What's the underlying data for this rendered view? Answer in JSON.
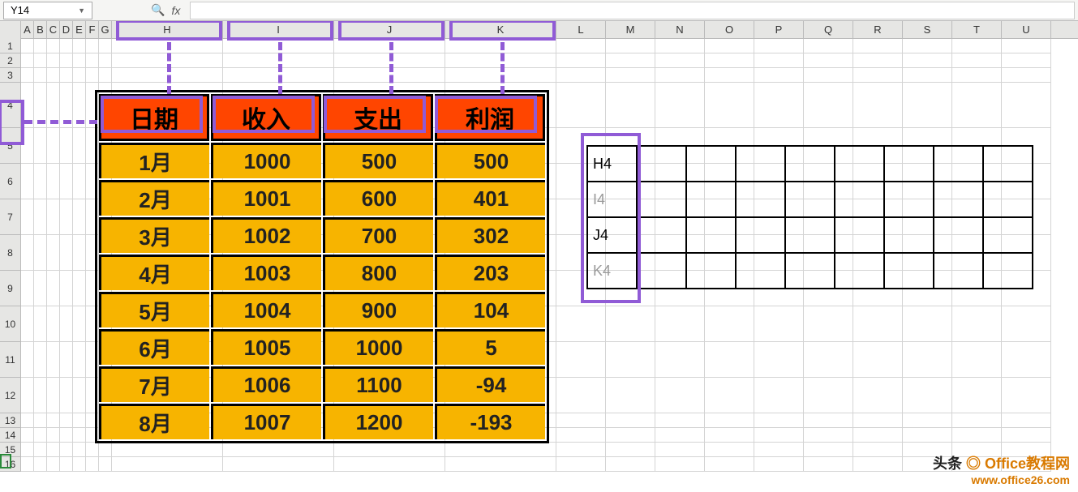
{
  "namebox": "Y14",
  "fx_label": "fx",
  "columns": {
    "narrow": [
      "A",
      "B",
      "C",
      "D",
      "E",
      "F",
      "G"
    ],
    "wide": [
      "H",
      "I",
      "J",
      "K"
    ],
    "rest": [
      "L",
      "M",
      "N",
      "O",
      "P",
      "Q",
      "R",
      "S",
      "T",
      "U"
    ]
  },
  "rows_small": [
    "1",
    "2",
    "3"
  ],
  "row_header4": "4",
  "rows_data": [
    "5",
    "6",
    "7",
    "8",
    "9",
    "10",
    "11",
    "12"
  ],
  "rows_tail": [
    "13",
    "14",
    "15",
    "16"
  ],
  "table": {
    "headers": [
      "日期",
      "收入",
      "支出",
      "利润"
    ],
    "rows": [
      [
        "1月",
        "1000",
        "500",
        "500"
      ],
      [
        "2月",
        "1001",
        "600",
        "401"
      ],
      [
        "3月",
        "1002",
        "700",
        "302"
      ],
      [
        "4月",
        "1003",
        "800",
        "203"
      ],
      [
        "5月",
        "1004",
        "900",
        "104"
      ],
      [
        "6月",
        "1005",
        "1000",
        "5"
      ],
      [
        "7月",
        "1006",
        "1100",
        "-94"
      ],
      [
        "8月",
        "1007",
        "1200",
        "-193"
      ]
    ]
  },
  "refs": [
    "H4",
    "I4",
    "J4",
    "K4"
  ],
  "watermark": {
    "line1_a": "头条",
    "line1_b": "Office教程网",
    "line2": "www.office26.com"
  },
  "chart_data": {
    "type": "table",
    "title": "",
    "columns": [
      "日期",
      "收入",
      "支出",
      "利润"
    ],
    "rows": [
      {
        "日期": "1月",
        "收入": 1000,
        "支出": 500,
        "利润": 500
      },
      {
        "日期": "2月",
        "收入": 1001,
        "支出": 600,
        "利润": 401
      },
      {
        "日期": "3月",
        "收入": 1002,
        "支出": 700,
        "利润": 302
      },
      {
        "日期": "4月",
        "收入": 1003,
        "支出": 800,
        "利润": 203
      },
      {
        "日期": "5月",
        "收入": 1004,
        "支出": 900,
        "利润": 104
      },
      {
        "日期": "6月",
        "收入": 1005,
        "支出": 1000,
        "利润": 5
      },
      {
        "日期": "7月",
        "收入": 1006,
        "支出": 1100,
        "利润": -94
      },
      {
        "日期": "8月",
        "收入": 1007,
        "支出": 1200,
        "利润": -193
      }
    ]
  }
}
